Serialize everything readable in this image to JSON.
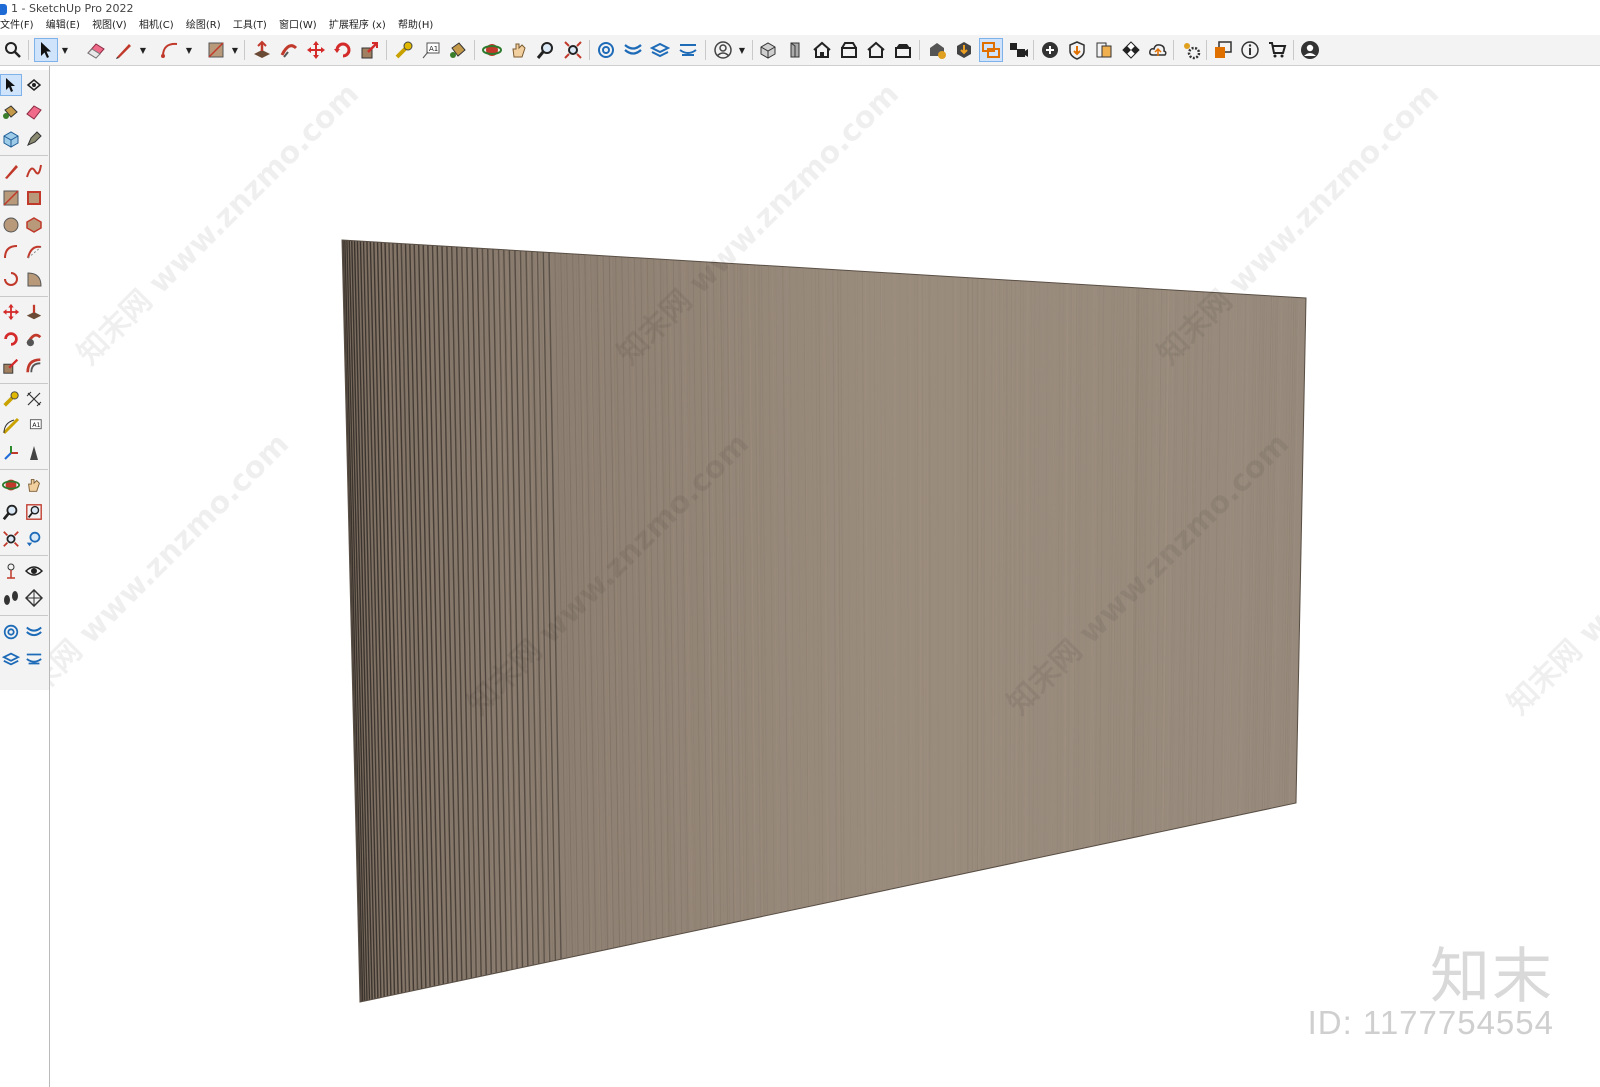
{
  "window": {
    "title": "1 - SketchUp Pro 2022"
  },
  "menu": [
    "文件(F)",
    "编辑(E)",
    "视图(V)",
    "相机(C)",
    "绘图(R)",
    "工具(T)",
    "窗口(W)",
    "扩展程序 (x)",
    "帮助(H)"
  ],
  "watermark": {
    "site": "知末网 www.znzmo.com",
    "brand": "知末",
    "id_label": "ID: 1177754554"
  },
  "colors": {
    "wall_light": "#9a8c7d",
    "wall_dark": "#7d6f62",
    "groove": "#2e2823",
    "toolbar_bg": "#f3f3f3",
    "selection": "#cfe3fa"
  },
  "icons_top": [
    "search-icon",
    "select-icon",
    "eraser-icon",
    "pencil-icon",
    "arc-icon",
    "paint-icon",
    "pushpull-icon",
    "followme-icon",
    "move-icon",
    "rotate-icon",
    "scale-icon",
    "tape-icon",
    "text-icon",
    "paint-bucket-icon",
    "orbit-icon",
    "pan-icon",
    "zoom-icon",
    "zoom-extents-icon",
    "sandbox-icon",
    "sandbox-smoove-icon",
    "sandbox-stamp-icon",
    "sandbox-drape-icon",
    "account-icon",
    "iso-view-icon",
    "top-view-icon",
    "front-view-icon",
    "right-view-icon",
    "back-view-icon",
    "left-view-icon",
    "warehouse-icon",
    "share-icon",
    "scenes-icon",
    "addlocation-icon",
    "solid-icon",
    "styles-icon",
    "shadow-icon",
    "cloud-icon",
    "extensions-icon",
    "layout-icon",
    "info-icon",
    "cart-icon",
    "user-icon"
  ],
  "icons_left": [
    "select-icon",
    "orbit-icon",
    "paint-bucket-icon",
    "eraser-icon",
    "component-icon",
    "tag-icon",
    "line-icon",
    "freehand-icon",
    "rectangle-icon",
    "rotated-rect-icon",
    "circle-icon",
    "polygon-icon",
    "arc-icon",
    "arc2-icon",
    "pie-icon",
    "arc3-icon",
    "move-icon",
    "pushpull-icon",
    "rotate-icon",
    "followme-icon",
    "scale-icon",
    "offset-icon",
    "tape-icon",
    "dimension-icon",
    "protractor-icon",
    "text-icon",
    "axes-icon",
    "3dtext-icon",
    "orbit2-icon",
    "pan-icon",
    "zoom-icon",
    "zoom-window-icon",
    "zoom-extents-icon",
    "previous-view-icon",
    "position-camera-icon",
    "lookaround-icon",
    "walk-icon",
    "section-icon",
    "sandbox-contours-icon",
    "sandbox-smoove-icon",
    "sandbox-stamp-icon",
    "sandbox-drape-icon"
  ]
}
